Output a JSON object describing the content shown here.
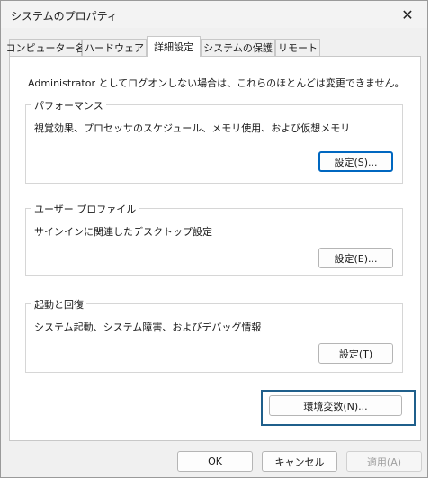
{
  "window": {
    "title": "システムのプロパティ",
    "close_glyph": "✕"
  },
  "tabs": [
    {
      "label": "コンピューター名",
      "active": false
    },
    {
      "label": "ハードウェア",
      "active": false
    },
    {
      "label": "詳細設定",
      "active": true
    },
    {
      "label": "システムの保護",
      "active": false
    },
    {
      "label": "リモート",
      "active": false
    }
  ],
  "panel": {
    "admin_note": "Administrator としてログオンしない場合は、これらのほとんどは変更できません。",
    "performance": {
      "legend": "パフォーマンス",
      "description": "視覚効果、プロセッサのスケジュール、メモリ使用、および仮想メモリ",
      "button": "設定(S)..."
    },
    "user_profiles": {
      "legend": "ユーザー プロファイル",
      "description": "サインインに関連したデスクトップ設定",
      "button": "設定(E)..."
    },
    "startup_recovery": {
      "legend": "起動と回復",
      "description": "システム起動、システム障害、およびデバッグ情報",
      "button": "設定(T)"
    },
    "env_button": "環境変数(N)..."
  },
  "footer": {
    "ok": "OK",
    "cancel": "キャンセル",
    "apply": "適用(A)"
  },
  "colors": {
    "focus_border": "#0067c0",
    "highlight_box": "#1f5f8b"
  }
}
